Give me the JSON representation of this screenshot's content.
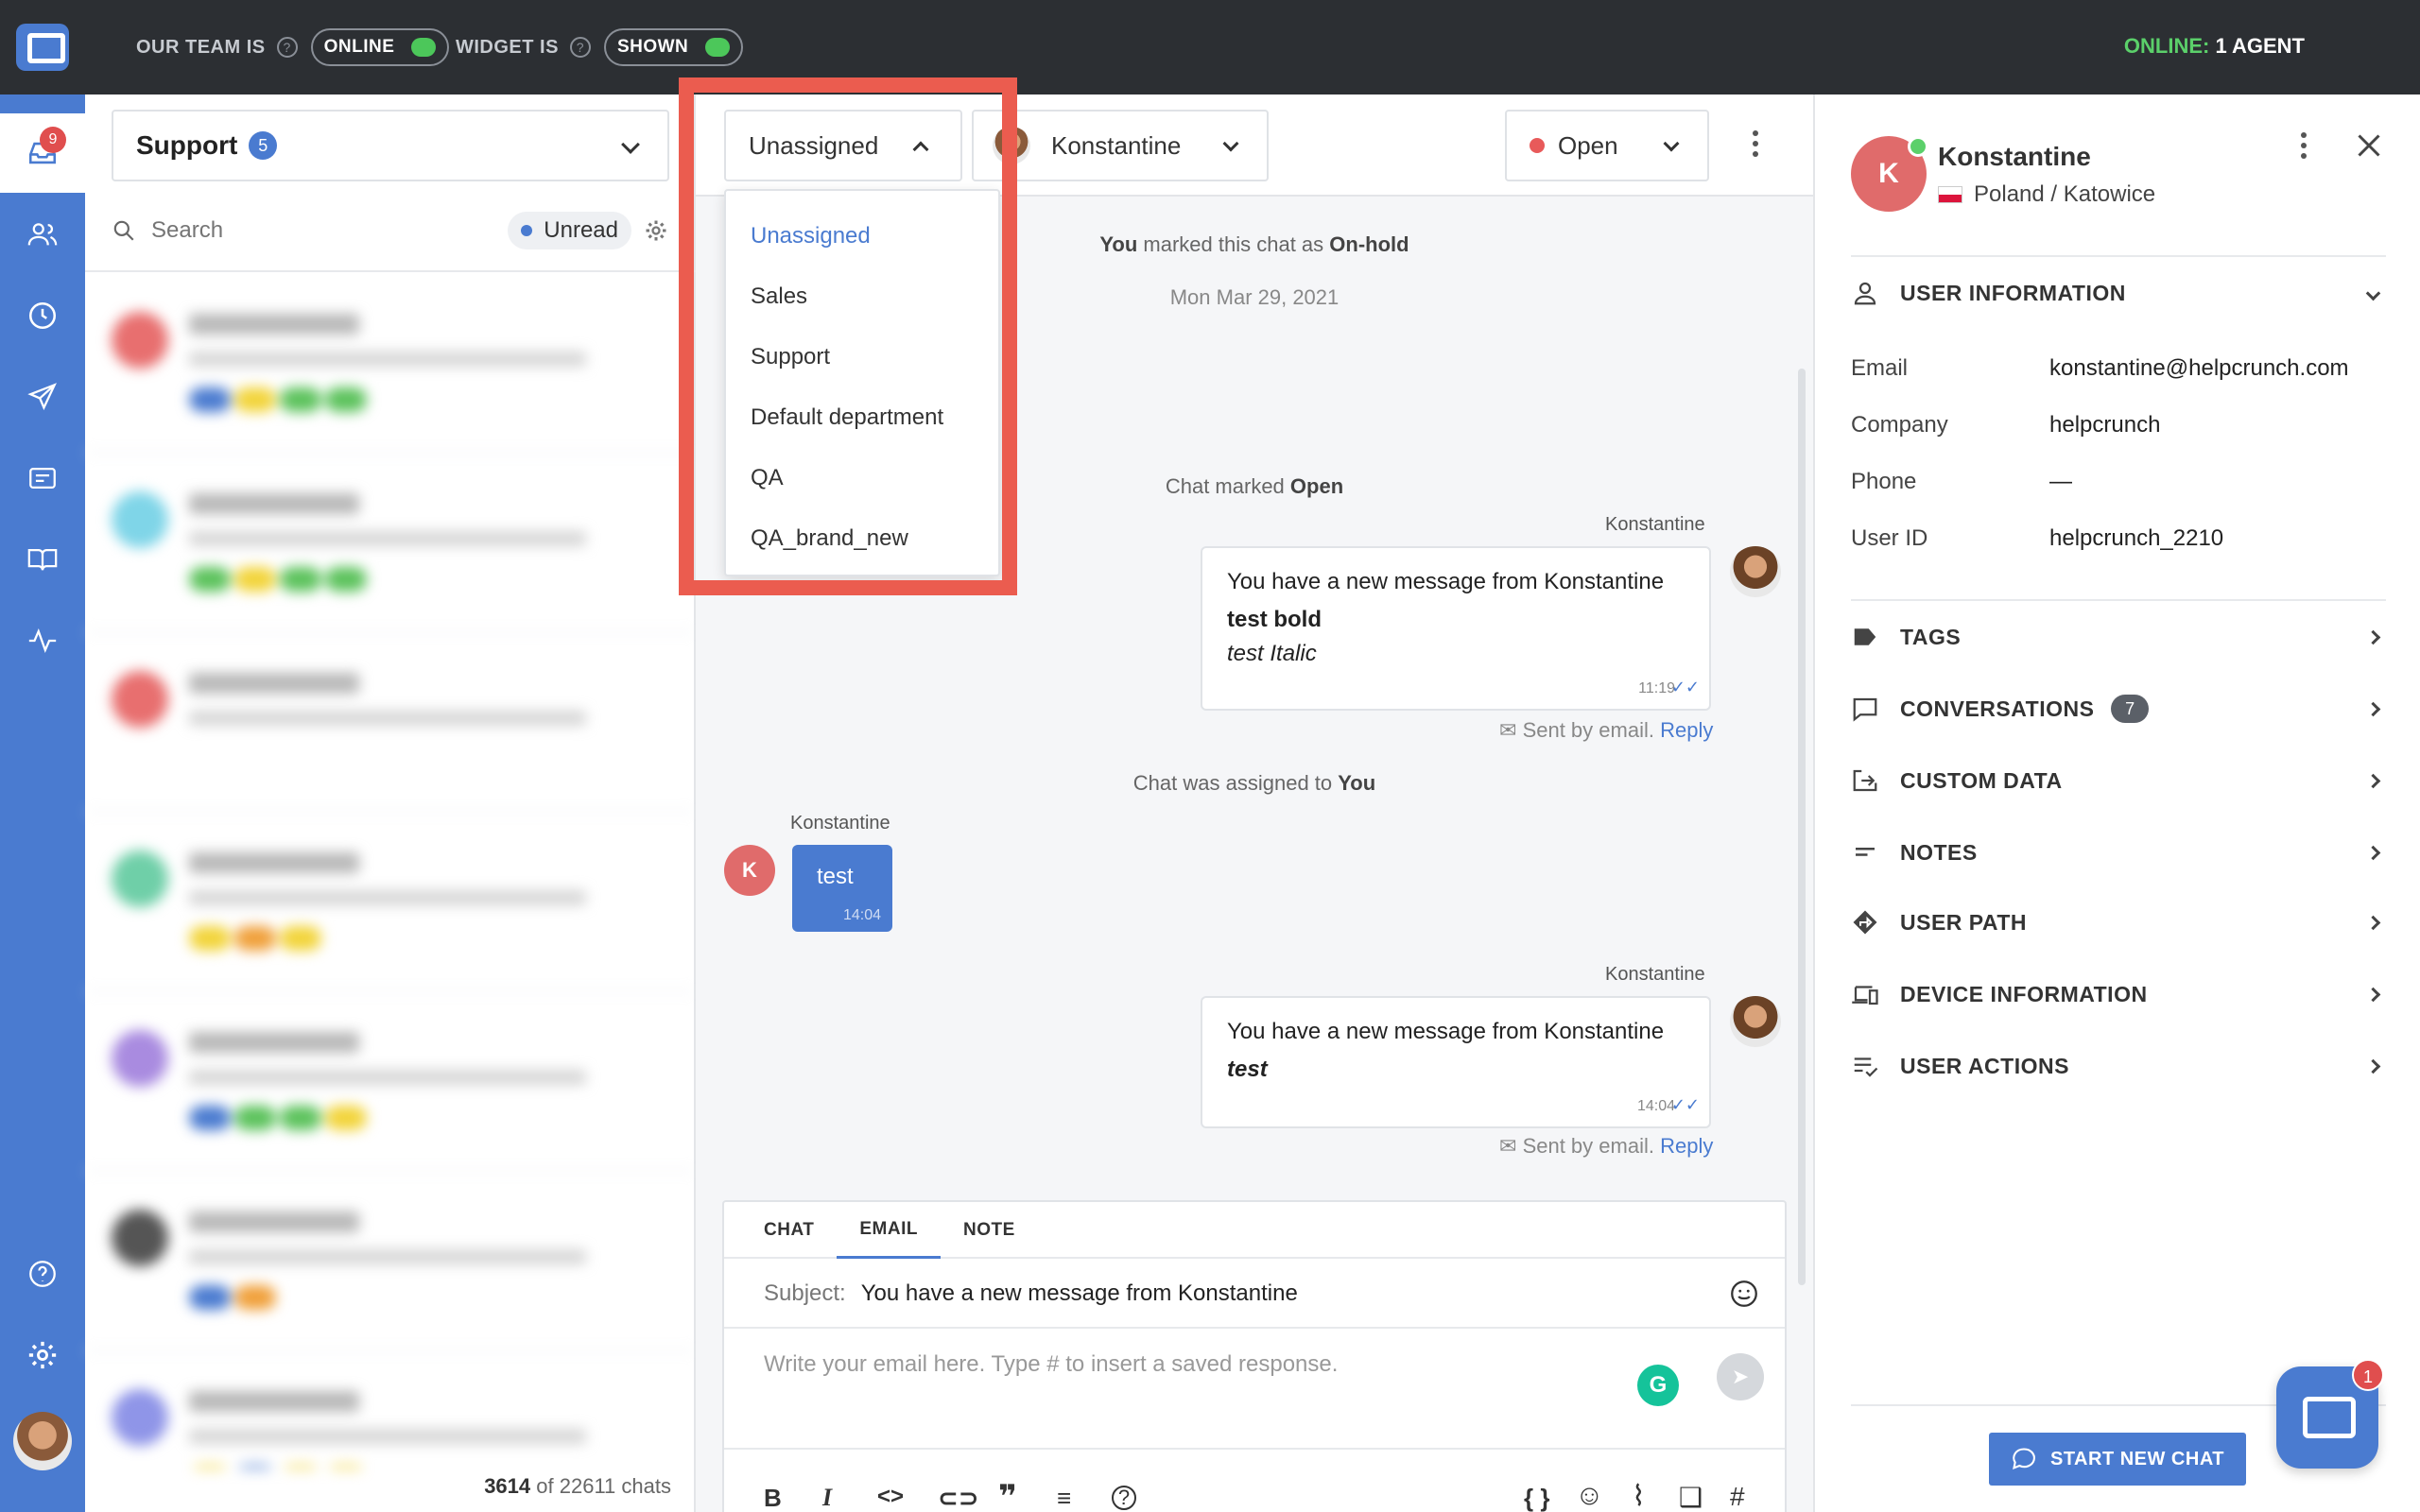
{
  "topbar": {
    "team_label": "OUR TEAM IS",
    "team_status": "ONLINE",
    "widget_label": "WIDGET IS",
    "widget_status": "SHOWN",
    "online_label": "ONLINE:",
    "online_value": "1 AGENT"
  },
  "nav": {
    "inbox_badge": "9"
  },
  "list": {
    "department": "Support",
    "department_count": "5",
    "search_placeholder": "Search",
    "unread_label": "Unread",
    "footer_count": "3614",
    "footer_of": "of",
    "footer_total": "22611 chats"
  },
  "header": {
    "assign_selected": "Unassigned",
    "agent_name": "Konstantine",
    "status": "Open"
  },
  "dropdown": {
    "items": [
      "Unassigned",
      "Sales",
      "Support",
      "Default department",
      "QA",
      "QA_brand_new"
    ]
  },
  "messages": {
    "sys1_you": "You",
    "sys1_text": "marked this chat as",
    "sys1_status": "On-hold",
    "date": "Mon Mar 29, 2021",
    "sys2_text": "Chat marked",
    "sys2_status": "Open",
    "m1_author": "Konstantine",
    "m1_line1": "You have a new message from Konstantine",
    "m1_line2": "test bold",
    "m1_line3": "test Italic",
    "m1_time": "11:19",
    "sent_by_email": "Sent by email.",
    "reply": "Reply",
    "sys3_text": "Chat was assigned to",
    "sys3_you": "You",
    "m2_author": "Konstantine",
    "m2_avatar_letter": "K",
    "m2_text": "test",
    "m2_time": "14:04",
    "m3_author": "Konstantine",
    "m3_line1": "You have a new message from Konstantine",
    "m3_line2": "test",
    "m3_time": "14:04"
  },
  "composer": {
    "tabs": [
      "CHAT",
      "EMAIL",
      "NOTE"
    ],
    "subject_label": "Subject:",
    "subject_value": "You have a new message from Konstantine",
    "body_placeholder": "Write your email here. Type # to insert a saved response.",
    "grammarly_letter": "G",
    "code_vars": "{ }"
  },
  "contact": {
    "avatar_letter": "K",
    "name": "Konstantine",
    "location": "Poland / Katowice",
    "user_info_title": "USER INFORMATION",
    "fields": [
      {
        "label": "Email",
        "value": "konstantine@helpcrunch.com"
      },
      {
        "label": "Company",
        "value": "helpcrunch"
      },
      {
        "label": "Phone",
        "value": "—"
      },
      {
        "label": "User ID",
        "value": "helpcrunch_2210"
      }
    ],
    "sections": {
      "tags": "TAGS",
      "conversations": "CONVERSATIONS",
      "conversations_count": "7",
      "custom_data": "CUSTOM DATA",
      "notes": "NOTES",
      "user_path": "USER PATH",
      "device_info": "DEVICE INFORMATION",
      "user_actions": "USER ACTIONS"
    },
    "start_chat": "START NEW CHAT"
  },
  "widget": {
    "badge": "1"
  }
}
